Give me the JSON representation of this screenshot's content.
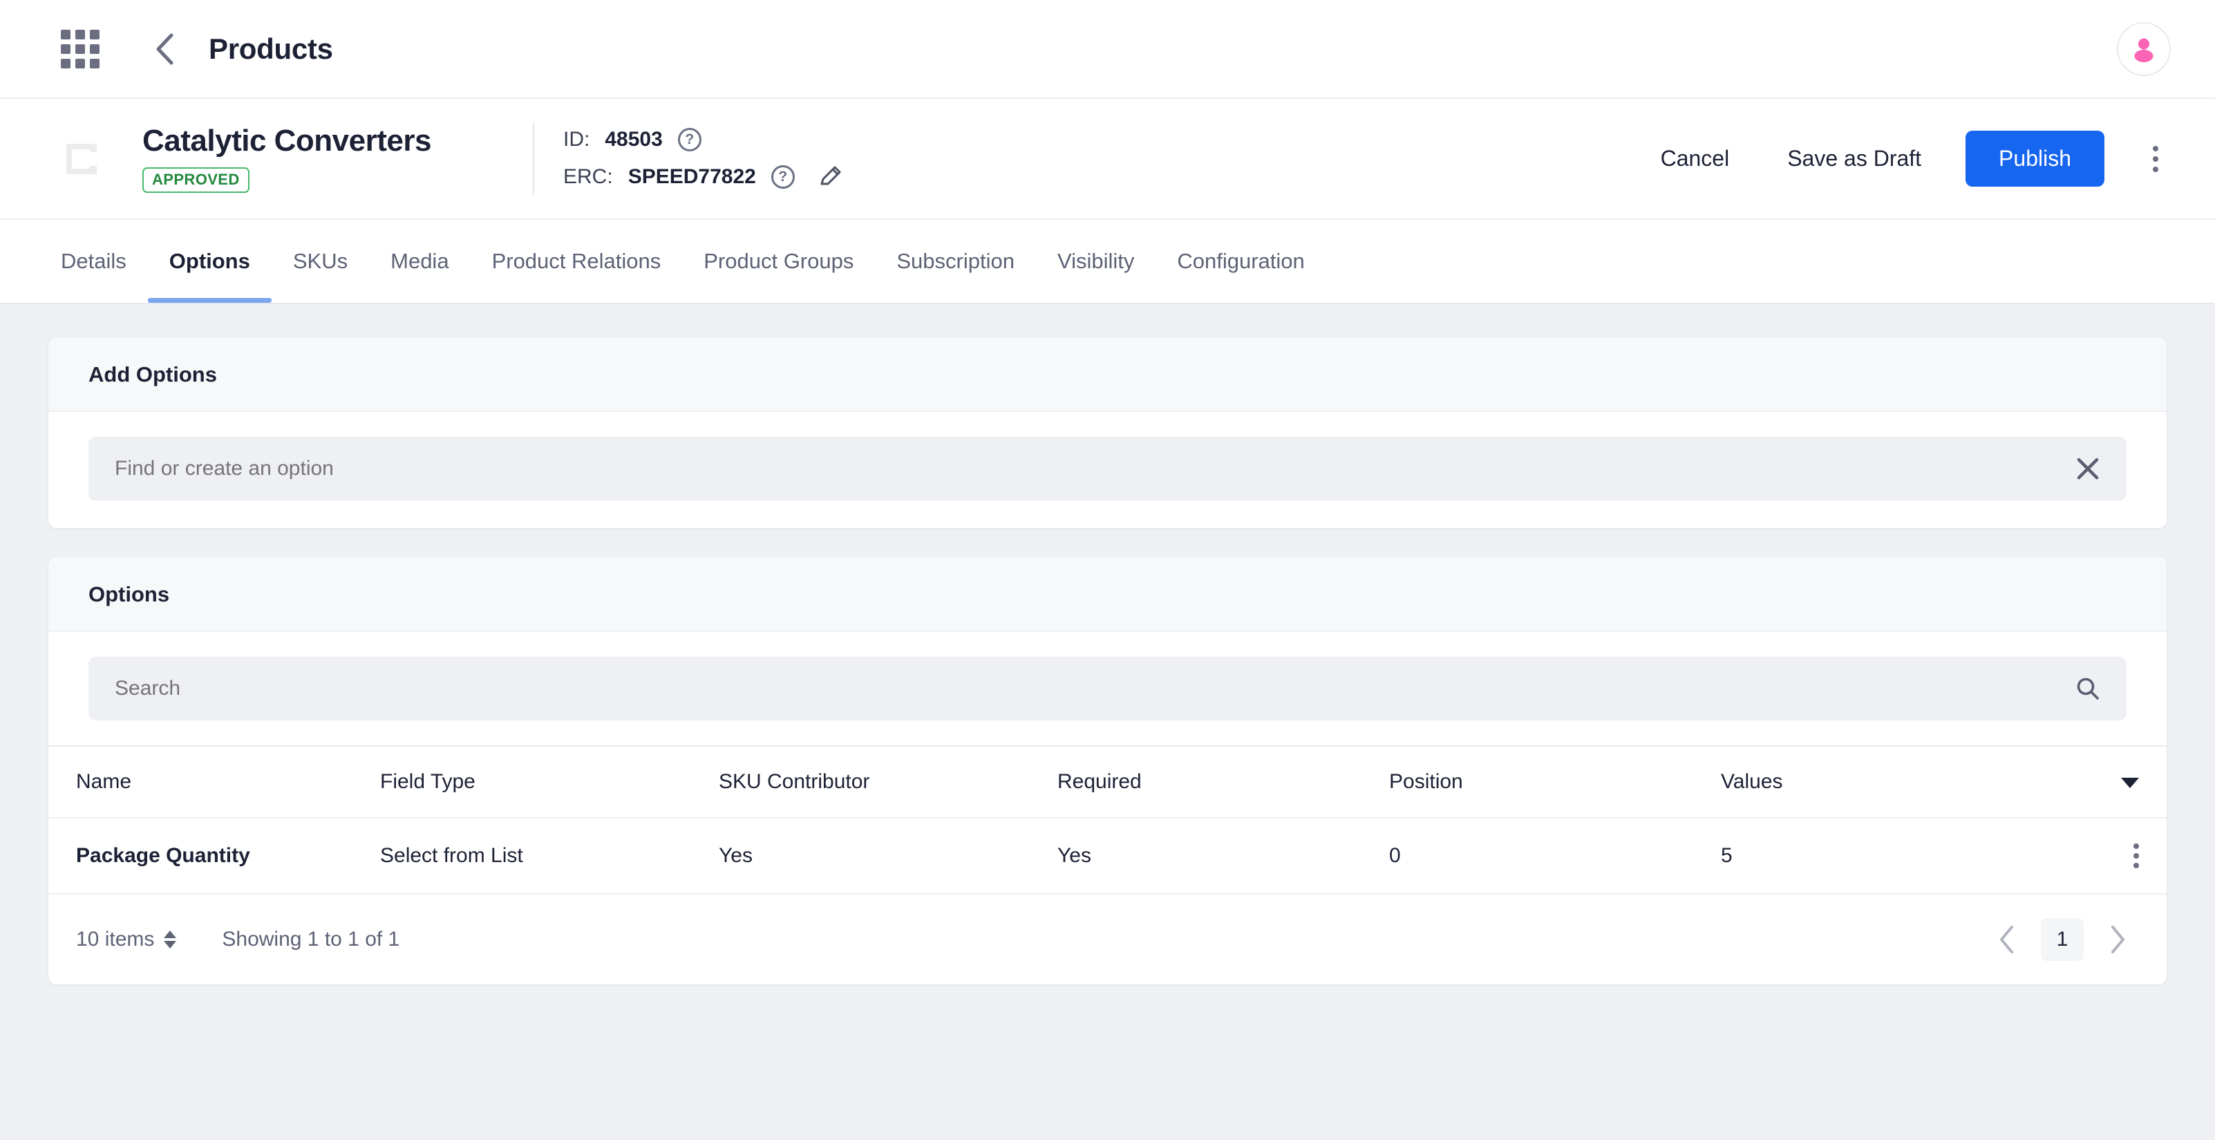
{
  "topbar": {
    "apps_icon": "grid-apps-icon",
    "back_icon": "chevron-left-icon",
    "title": "Products",
    "avatar_icon": "user-avatar-icon"
  },
  "product_header": {
    "thumbnail_icon": "image-placeholder-icon",
    "name": "Catalytic Converters",
    "status_badge": "APPROVED",
    "id_label": "ID:",
    "id_value": "48503",
    "erc_label": "ERC:",
    "erc_value": "SPEED77822",
    "help_icon": "help-circle-icon",
    "edit_icon": "pencil-edit-icon",
    "actions": {
      "cancel": "Cancel",
      "save_draft": "Save as Draft",
      "publish": "Publish",
      "more_icon": "kebab-menu-icon"
    }
  },
  "tabs": [
    {
      "label": "Details",
      "active": false
    },
    {
      "label": "Options",
      "active": true
    },
    {
      "label": "SKUs",
      "active": false
    },
    {
      "label": "Media",
      "active": false
    },
    {
      "label": "Product Relations",
      "active": false
    },
    {
      "label": "Product Groups",
      "active": false
    },
    {
      "label": "Subscription",
      "active": false
    },
    {
      "label": "Visibility",
      "active": false
    },
    {
      "label": "Configuration",
      "active": false
    }
  ],
  "add_options_card": {
    "title": "Add Options",
    "input_value": "",
    "input_placeholder": "Find or create an option",
    "clear_icon": "close-x-icon"
  },
  "options_card": {
    "title": "Options",
    "search_value": "",
    "search_placeholder": "Search",
    "search_icon": "search-icon",
    "sort_icon": "caret-down-icon",
    "columns": [
      "Name",
      "Field Type",
      "SKU Contributor",
      "Required",
      "Position",
      "Values"
    ],
    "rows": [
      {
        "name": "Package Quantity",
        "field_type": "Select from List",
        "sku_contributor": "Yes",
        "required": "Yes",
        "position": "0",
        "values": "5",
        "row_menu_icon": "kebab-menu-icon"
      }
    ],
    "footer": {
      "items_per_page": "10 items",
      "items_stepper_icon": "up-down-caret-icon",
      "showing": "Showing 1 to 1 of 1",
      "prev_icon": "chevron-left-icon",
      "current_page": "1",
      "next_icon": "chevron-right-icon"
    }
  },
  "colors": {
    "accent_blue": "#1766f0",
    "tab_underline": "#7aa7ef",
    "badge_green": "#23883f",
    "badge_border": "#49b96a",
    "avatar_pink": "#fb63b5",
    "page_bg": "#eef0f4"
  }
}
